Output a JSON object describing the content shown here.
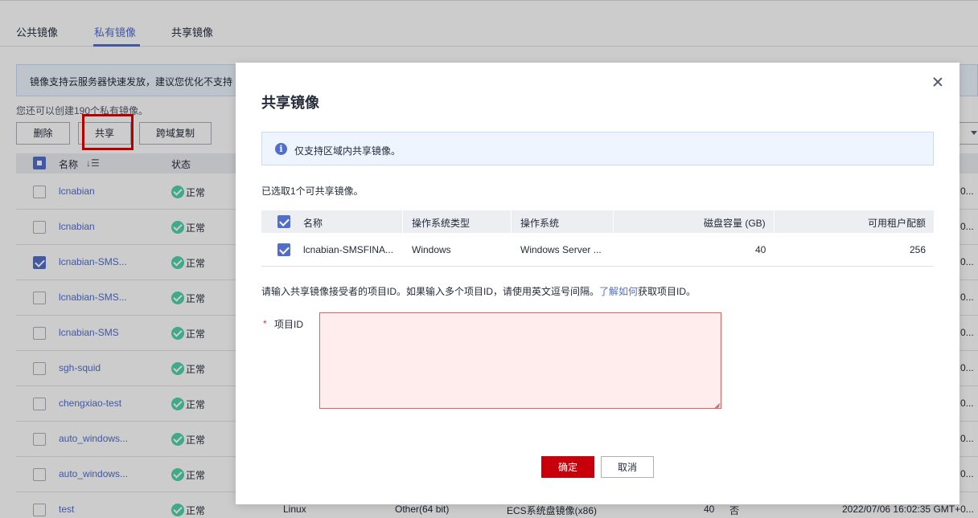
{
  "tabs": [
    {
      "label": "公共镜像"
    },
    {
      "label": "私有镜像"
    },
    {
      "label": "共享镜像"
    }
  ],
  "notice": "镜像支持云服务器快速发放，建议您优化不支持",
  "quota_text": "您还可以创建190个私有镜像。",
  "toolbar": {
    "delete": "删除",
    "share": "共享",
    "copy": "跨域复制"
  },
  "table": {
    "col_name": "名称",
    "col_status": "状态",
    "rows": [
      {
        "name": "lcnabian",
        "status": "正常",
        "right": "0..."
      },
      {
        "name": "lcnabian",
        "status": "正常",
        "right": "0..."
      },
      {
        "name": "lcnabian-SMS...",
        "status": "正常",
        "right": "0..."
      },
      {
        "name": "lcnabian-SMS...",
        "status": "正常",
        "right": "0..."
      },
      {
        "name": "lcnabian-SMS",
        "status": "正常",
        "right": "0..."
      },
      {
        "name": "sgh-squid",
        "status": "正常",
        "right": "0..."
      },
      {
        "name": "chengxiao-test",
        "status": "正常",
        "right": "0..."
      },
      {
        "name": "auto_windows...",
        "status": "正常",
        "right": "0..."
      },
      {
        "name": "auto_windows...",
        "status": "正常",
        "right": "0..."
      },
      {
        "name": "test",
        "status": "正常",
        "os": "Linux",
        "arch": "Other(64 bit)",
        "type": "ECS系统盘镜像(x86)",
        "disk": "40",
        "flag": "否",
        "created": "2022/07/06 16:02:35 GMT+0..."
      }
    ]
  },
  "dialog": {
    "title": "共享镜像",
    "info": "仅支持区域内共享镜像。",
    "selected": "已选取1个可共享镜像。",
    "headers": {
      "name": "名称",
      "os_type": "操作系统类型",
      "os": "操作系统",
      "disk": "磁盘容量 (GB)",
      "quota": "可用租户配额"
    },
    "row": {
      "name": "lcnabian-SMSFINA...",
      "os_type": "Windows",
      "os": "Windows Server ...",
      "disk": "40",
      "quota": "256"
    },
    "hint_before": "请输入共享镜像接受者的项目ID。如果输入多个项目ID，请使用英文逗号间隔。",
    "hint_link": "了解如何",
    "hint_after": "获取项目ID。",
    "required_mark": "*",
    "field_label": "项目ID",
    "field_value": "",
    "ok": "确定",
    "cancel": "取消"
  },
  "colors": {
    "accent": "#526ecc",
    "primary_button": "#c7000b",
    "error_border": "#e55e5e",
    "highlight": "#e40000"
  }
}
